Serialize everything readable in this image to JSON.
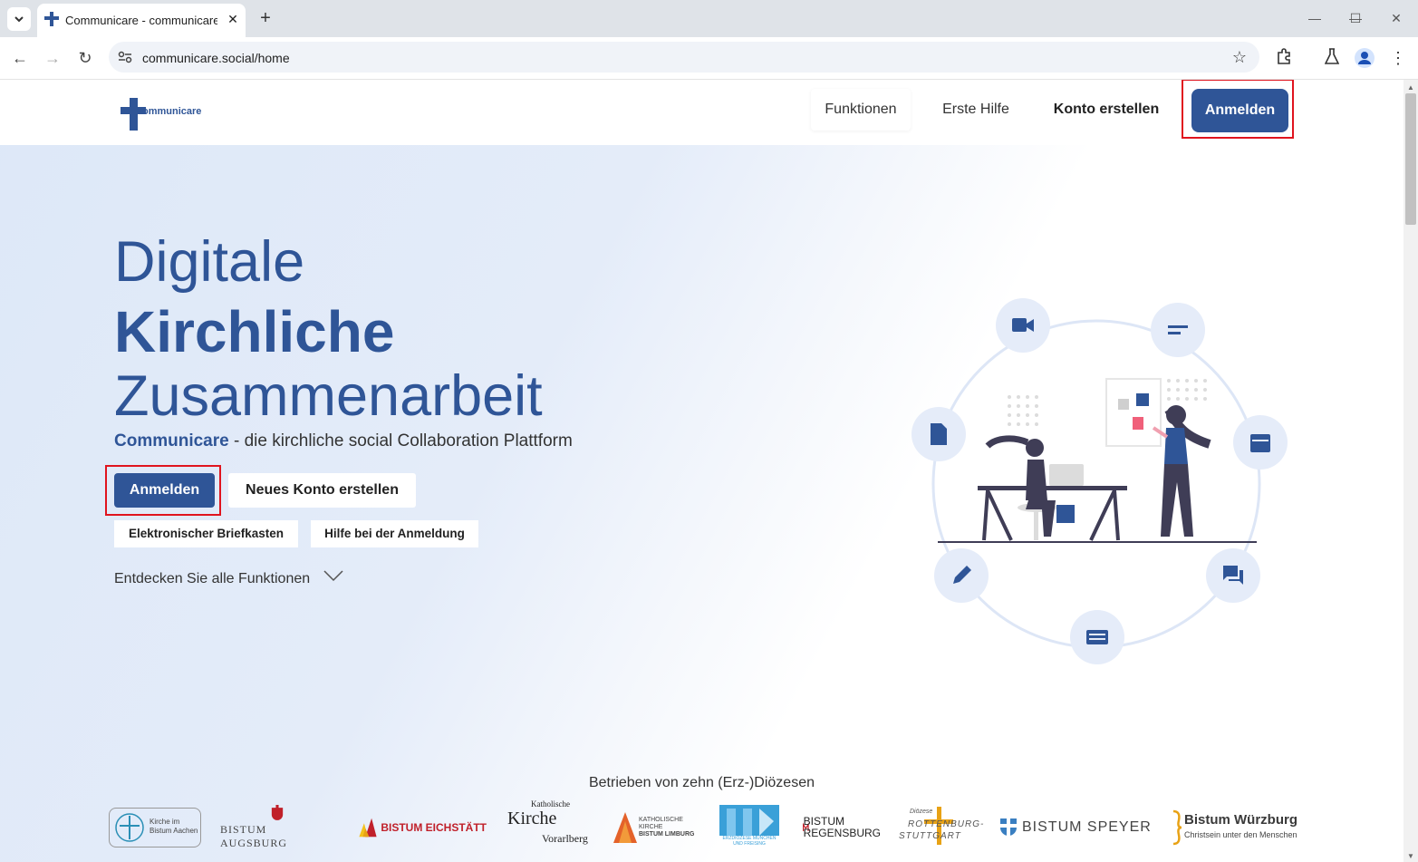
{
  "browser": {
    "tab_title": "Communicare - communicare.social",
    "url": "communicare.social/home",
    "window_controls": {
      "minimize": "—",
      "maximize": "☐",
      "close": "✕"
    }
  },
  "header": {
    "logo_text": "ommunicare",
    "nav": {
      "functions": "Funktionen",
      "first_aid": "Erste Hilfe",
      "create_account": "Konto erstellen",
      "login": "Anmelden"
    }
  },
  "hero": {
    "line1": "Digitale",
    "line2": "Kirchliche",
    "line3": "Zusammenarbeit",
    "tagline_brand": "Communicare",
    "tagline_rest": " - die kirchliche social Collaboration Plattform",
    "login_button": "Anmelden",
    "new_account_button": "Neues Konto erstellen",
    "mailbox_button": "Elektronischer Briefkasten",
    "login_help_button": "Hilfe bei der Anmeldung",
    "discover_text": "Entdecken Sie alle Funktionen"
  },
  "footer": {
    "operated_by": "Betrieben von zehn (Erz-)Diözesen",
    "dioceses": [
      {
        "line1": "Kirche im",
        "line2": "Bistum Aachen"
      },
      {
        "line1": "BISTUM AUGSBURG"
      },
      {
        "line1": "BISTUM EICHSTÄTT"
      },
      {
        "top": "Katholische",
        "line1": "Kirche",
        "line2": "Vorarlberg"
      },
      {
        "line1": "KATHOLISCHE",
        "line2": "KIRCHE",
        "line3": "BISTUM LIMBURG"
      },
      {
        "line1": "ERZDIÖZESE MÜNCHEN",
        "line2": "UND FREISING"
      },
      {
        "line1": "BISTUM",
        "line2": "REGENSBURG"
      },
      {
        "top": "Diözese",
        "line1": "ROTTENBURG-",
        "line2": "STUTTGART"
      },
      {
        "line1": "BISTUM SPEYER"
      },
      {
        "line1": "Bistum Würzburg",
        "line2": "Christsein unter den Menschen"
      }
    ]
  },
  "colors": {
    "brand": "#2f5597",
    "highlight": "#e0141e",
    "accent_pink": "#f0607a"
  }
}
